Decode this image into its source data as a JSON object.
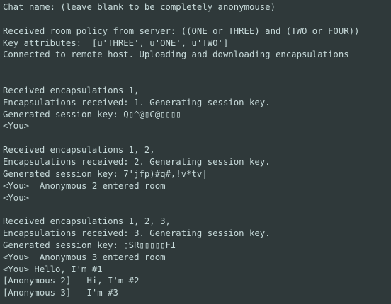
{
  "terminal": {
    "text_color": "#c7dada",
    "background": "#2f393a",
    "lines": [
      "Chat name: (leave blank to be completely anonymouse)",
      "",
      "Received room policy from server: ((ONE or THREE) and (TWO or FOUR))",
      "Key attributes:  [u'THREE', u'ONE', u'TWO']",
      "Connected to remote host. Uploading and downloading encapsulations",
      "",
      "",
      "Received encapsulations 1,",
      "Encapsulations received: 1. Generating session key.",
      "Generated session key: Q▯^@▯C@▯▯▯▯",
      "<You>",
      "",
      "Received encapsulations 1, 2,",
      "Encapsulations received: 2. Generating session key.",
      "Generated session key: 7'jfp)#q#,!v*tv|",
      "<You>  Anonymous 2 entered room",
      "<You>",
      "",
      "Received encapsulations 1, 2, 3,",
      "Encapsulations received: 3. Generating session key.",
      "Generated session key: ▯SR▯▯▯▯▯FI",
      "<You>  Anonymous 3 entered room",
      "<You> Hello, I'm #1",
      "[Anonymous 2]   Hi, I'm #2",
      "[Anonymous 3]   I'm #3"
    ]
  }
}
